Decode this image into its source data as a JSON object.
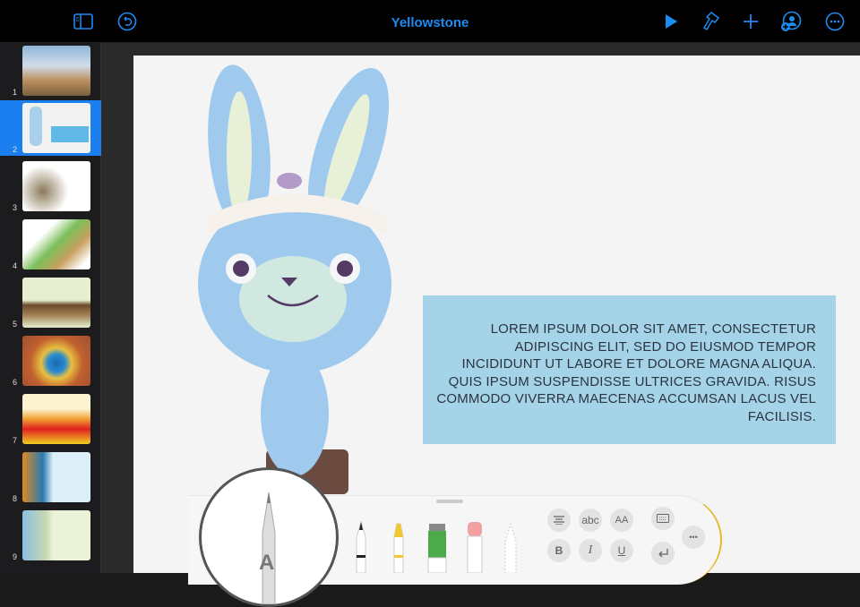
{
  "header": {
    "title": "Yellowstone",
    "icons": [
      "sidebar-icon",
      "undo-icon",
      "play-icon",
      "format-brush-icon",
      "add-icon",
      "collaborate-icon",
      "more-icon"
    ]
  },
  "slides": [
    {
      "num": "1"
    },
    {
      "num": "2"
    },
    {
      "num": "3"
    },
    {
      "num": "4"
    },
    {
      "num": "5"
    },
    {
      "num": "6"
    },
    {
      "num": "7"
    },
    {
      "num": "8"
    },
    {
      "num": "9"
    }
  ],
  "slide": {
    "body": "LOREM IPSUM DOLOR SIT AMET, CONSECTETUR ADIPISCING ELIT, SED DO EIUSMOD TEMPOR INCIDIDUNT UT LABORE ET DOLORE MAGNA ALIQUA. QUIS IPSUM SUSPENDISSE ULTRICES GRAVIDA. RISUS COMMODO VIVERRA MAECENAS ACCUMSAN LACUS VEL FACILISIS."
  },
  "toolbar": {
    "pencil_letter": "A",
    "abc": "abc",
    "text_size": "AA",
    "bold": "B",
    "italic": "I",
    "underline": "U",
    "more": "•••"
  },
  "colors": {
    "accent": "#1b8cf2",
    "textbox": "#a5d3e8"
  }
}
